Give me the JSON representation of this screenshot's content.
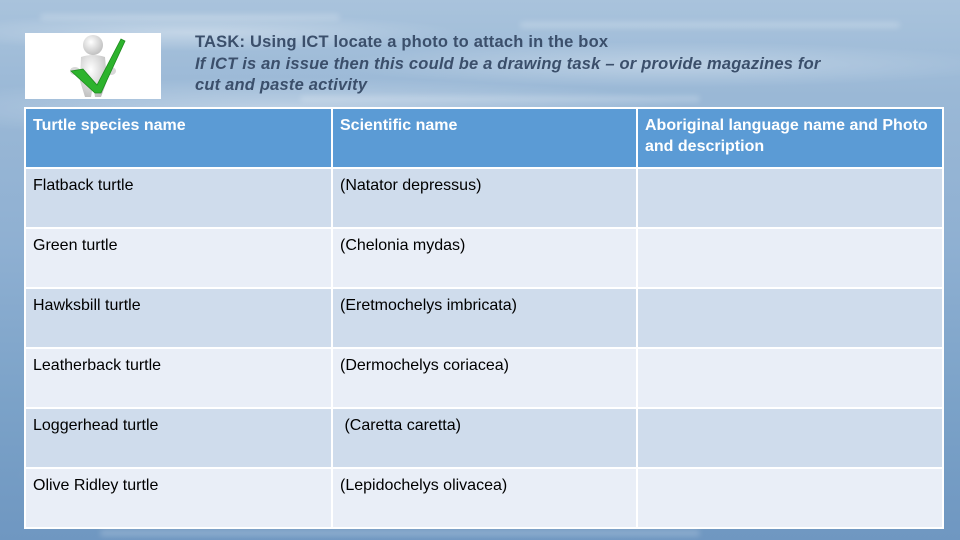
{
  "task": {
    "image": "person-with-green-checkmark",
    "line1": "TASK: Using ICT locate a photo to attach in the box",
    "line2": "If ICT is an issue then this could be a drawing task – or provide magazines for",
    "line3": "cut and paste activity"
  },
  "table": {
    "headers": [
      "Turtle species name",
      "Scientific name",
      "Aboriginal language name and Photo and description"
    ],
    "rows": [
      {
        "species": "Flatback turtle",
        "scientific": "(Natator depressus)",
        "aboriginal": ""
      },
      {
        "species": "Green turtle",
        "scientific": "(Chelonia mydas)",
        "aboriginal": ""
      },
      {
        "species": "Hawksbill turtle",
        "scientific": "(Eretmochelys imbricata)",
        "aboriginal": ""
      },
      {
        "species": "Leatherback turtle",
        "scientific": "(Dermochelys coriacea)",
        "aboriginal": ""
      },
      {
        "species": "Loggerhead turtle",
        "scientific": " (Caretta caretta)",
        "aboriginal": ""
      },
      {
        "species": "Olive Ridley turtle",
        "scientific": "(Lepidochelys olivacea)",
        "aboriginal": ""
      }
    ]
  },
  "colors": {
    "header_bg": "#5b9bd5",
    "row_odd_bg": "#cfdcec",
    "row_even_bg": "#e9eef7",
    "task_text": "#3b4f6b",
    "check_green": "#2db32d"
  }
}
